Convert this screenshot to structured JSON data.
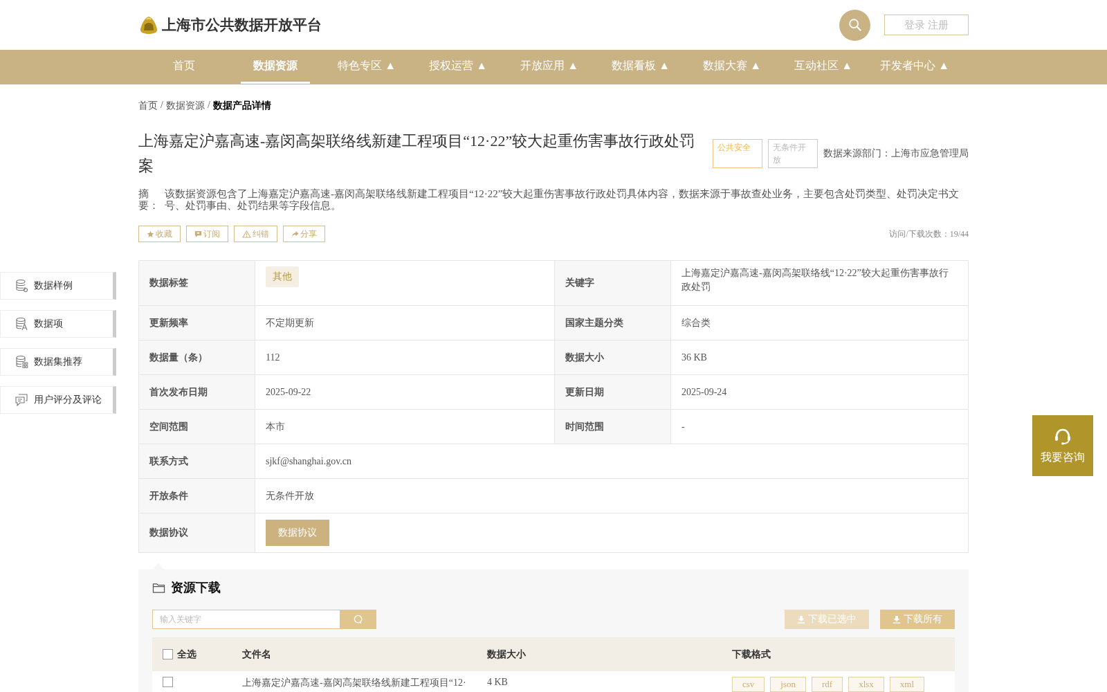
{
  "header": {
    "title": "上海市公共数据开放平台",
    "login": "登录 注册"
  },
  "nav": [
    {
      "label": "首页",
      "selected": false
    },
    {
      "label": "数据资源",
      "selected": true
    },
    {
      "label": "特色专区 ▲",
      "selected": false
    },
    {
      "label": "授权运营 ▲",
      "selected": false
    },
    {
      "label": "开放应用 ▲",
      "selected": false
    },
    {
      "label": "数据看板 ▲",
      "selected": false
    },
    {
      "label": "数据大赛 ▲",
      "selected": false
    },
    {
      "label": "互动社区 ▲",
      "selected": false
    },
    {
      "label": "开发者中心 ▲",
      "selected": false
    }
  ],
  "breadcrumb": {
    "separator": "/",
    "items": [
      "首页",
      "数据资源",
      "数据产品详情"
    ]
  },
  "title": "上海嘉定沪嘉高速-嘉闵高架联络线新建工程项目“12·22”较大起重伤害事故行政处罚案",
  "tags": [
    {
      "label": "公共安全",
      "kind": "highlight"
    },
    {
      "label": "无条件开放",
      "kind": "plain"
    }
  ],
  "source": "数据来源部门：上海市应急管理局",
  "abstract": {
    "label": "摘要：",
    "text": "该数据资源包含了上海嘉定沪嘉高速-嘉闵高架联络线新建工程项目“12·22”较大起重伤害事故行政处罚具体内容，数据来源于事故查处业务，主要包含处罚类型、处罚决定书文号、处罚事由、处罚结果等字段信息。"
  },
  "actions": [
    {
      "label": "收藏",
      "kind": "star"
    },
    {
      "label": "订阅",
      "kind": "subscribe"
    },
    {
      "label": "纠错",
      "kind": "warning"
    },
    {
      "label": "分享",
      "kind": "share"
    }
  ],
  "visits": "访问/下载次数：19/44",
  "sidebar": [
    {
      "label": "数据样例",
      "kind": "sample"
    },
    {
      "label": "数据项",
      "kind": "items"
    },
    {
      "label": "数据集推荐",
      "kind": "recommend"
    },
    {
      "label": "用户评分及评论",
      "kind": "comment"
    }
  ],
  "details": [
    [
      {
        "label": "数据标签",
        "value": "其他",
        "kind": "tag"
      },
      {
        "label": "关键字",
        "value": "上海嘉定沪嘉高速-嘉闵高架联络线“12·22”较大起重伤害事故行政处罚",
        "kind": "text"
      }
    ],
    [
      {
        "label": "更新频率",
        "value": "不定期更新",
        "kind": "text"
      },
      {
        "label": "国家主题分类",
        "value": "综合类",
        "kind": "text"
      }
    ],
    [
      {
        "label": "数据量（条）",
        "value": "112",
        "kind": "text"
      },
      {
        "label": "数据大小",
        "value": "36 KB",
        "kind": "text"
      }
    ],
    [
      {
        "label": "首次发布日期",
        "value": "2025-09-22",
        "kind": "text"
      },
      {
        "label": "更新日期",
        "value": "2025-09-24",
        "kind": "text"
      }
    ],
    [
      {
        "label": "空间范围",
        "value": "本市",
        "kind": "text"
      },
      {
        "label": "时间范围",
        "value": "-",
        "kind": "text"
      }
    ],
    [
      {
        "label": "联系方式",
        "value": "sjkf@shanghai.gov.cn",
        "kind": "text"
      }
    ],
    [
      {
        "label": "开放条件",
        "value": "无条件开放",
        "kind": "text"
      }
    ],
    [
      {
        "label": "数据协议",
        "value": "数据协议",
        "kind": "button"
      }
    ]
  ],
  "consult": "我要咨询",
  "download": {
    "title": "资源下载",
    "search_placeholder": "输入关键字",
    "buttons": [
      {
        "label": "下载已选中",
        "disabled": true
      },
      {
        "label": "下载所有",
        "disabled": false
      }
    ],
    "select_all": {
      "label": "全选",
      "checked": false
    },
    "columns": [
      "文件名",
      "数据大小",
      "下载格式"
    ],
    "rows": [
      {
        "checked": false,
        "name": "上海嘉定沪嘉高速-嘉闵高架联络线新建工程项目“12·",
        "size": "4 KB",
        "formats": [
          "csv",
          "json",
          "rdf",
          "xlsx",
          "xml"
        ]
      }
    ]
  }
}
